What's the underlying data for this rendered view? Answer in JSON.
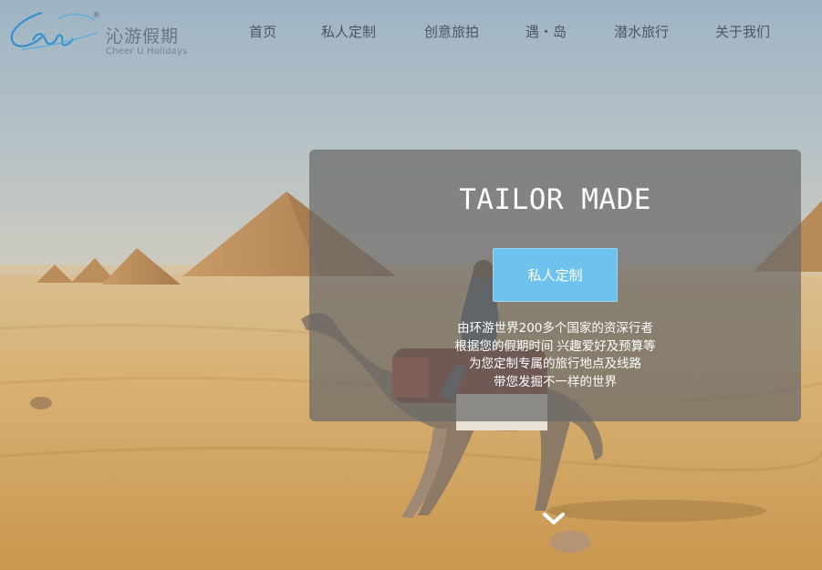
{
  "brand": {
    "name_cn": "沁游假期",
    "name_en": "Cheer U Holidays",
    "registered_mark": "®",
    "logo_icon": "script-signature-logo"
  },
  "nav": {
    "items": [
      {
        "label": "首页"
      },
      {
        "label": "私人定制"
      },
      {
        "label": "创意旅拍"
      },
      {
        "label": "遇・岛"
      },
      {
        "label": "潜水旅行"
      },
      {
        "label": "关于我们"
      }
    ]
  },
  "hero": {
    "title": "TAILOR MADE",
    "cta_label": "私人定制",
    "description": [
      "由环游世界200多个国家的资深行者",
      "根据您的假期时间 兴趣爱好及预算等",
      "为您定制专属的旅行地点及线路",
      "带您发掘不一样的世界"
    ],
    "scroll_icon": "chevron-down-icon"
  },
  "colors": {
    "accent": "#6ec3ee",
    "nav_text": "#4b5661",
    "card_overlay": "rgba(105,105,105,0.72)",
    "logo_blue": "#2f8fcf"
  }
}
